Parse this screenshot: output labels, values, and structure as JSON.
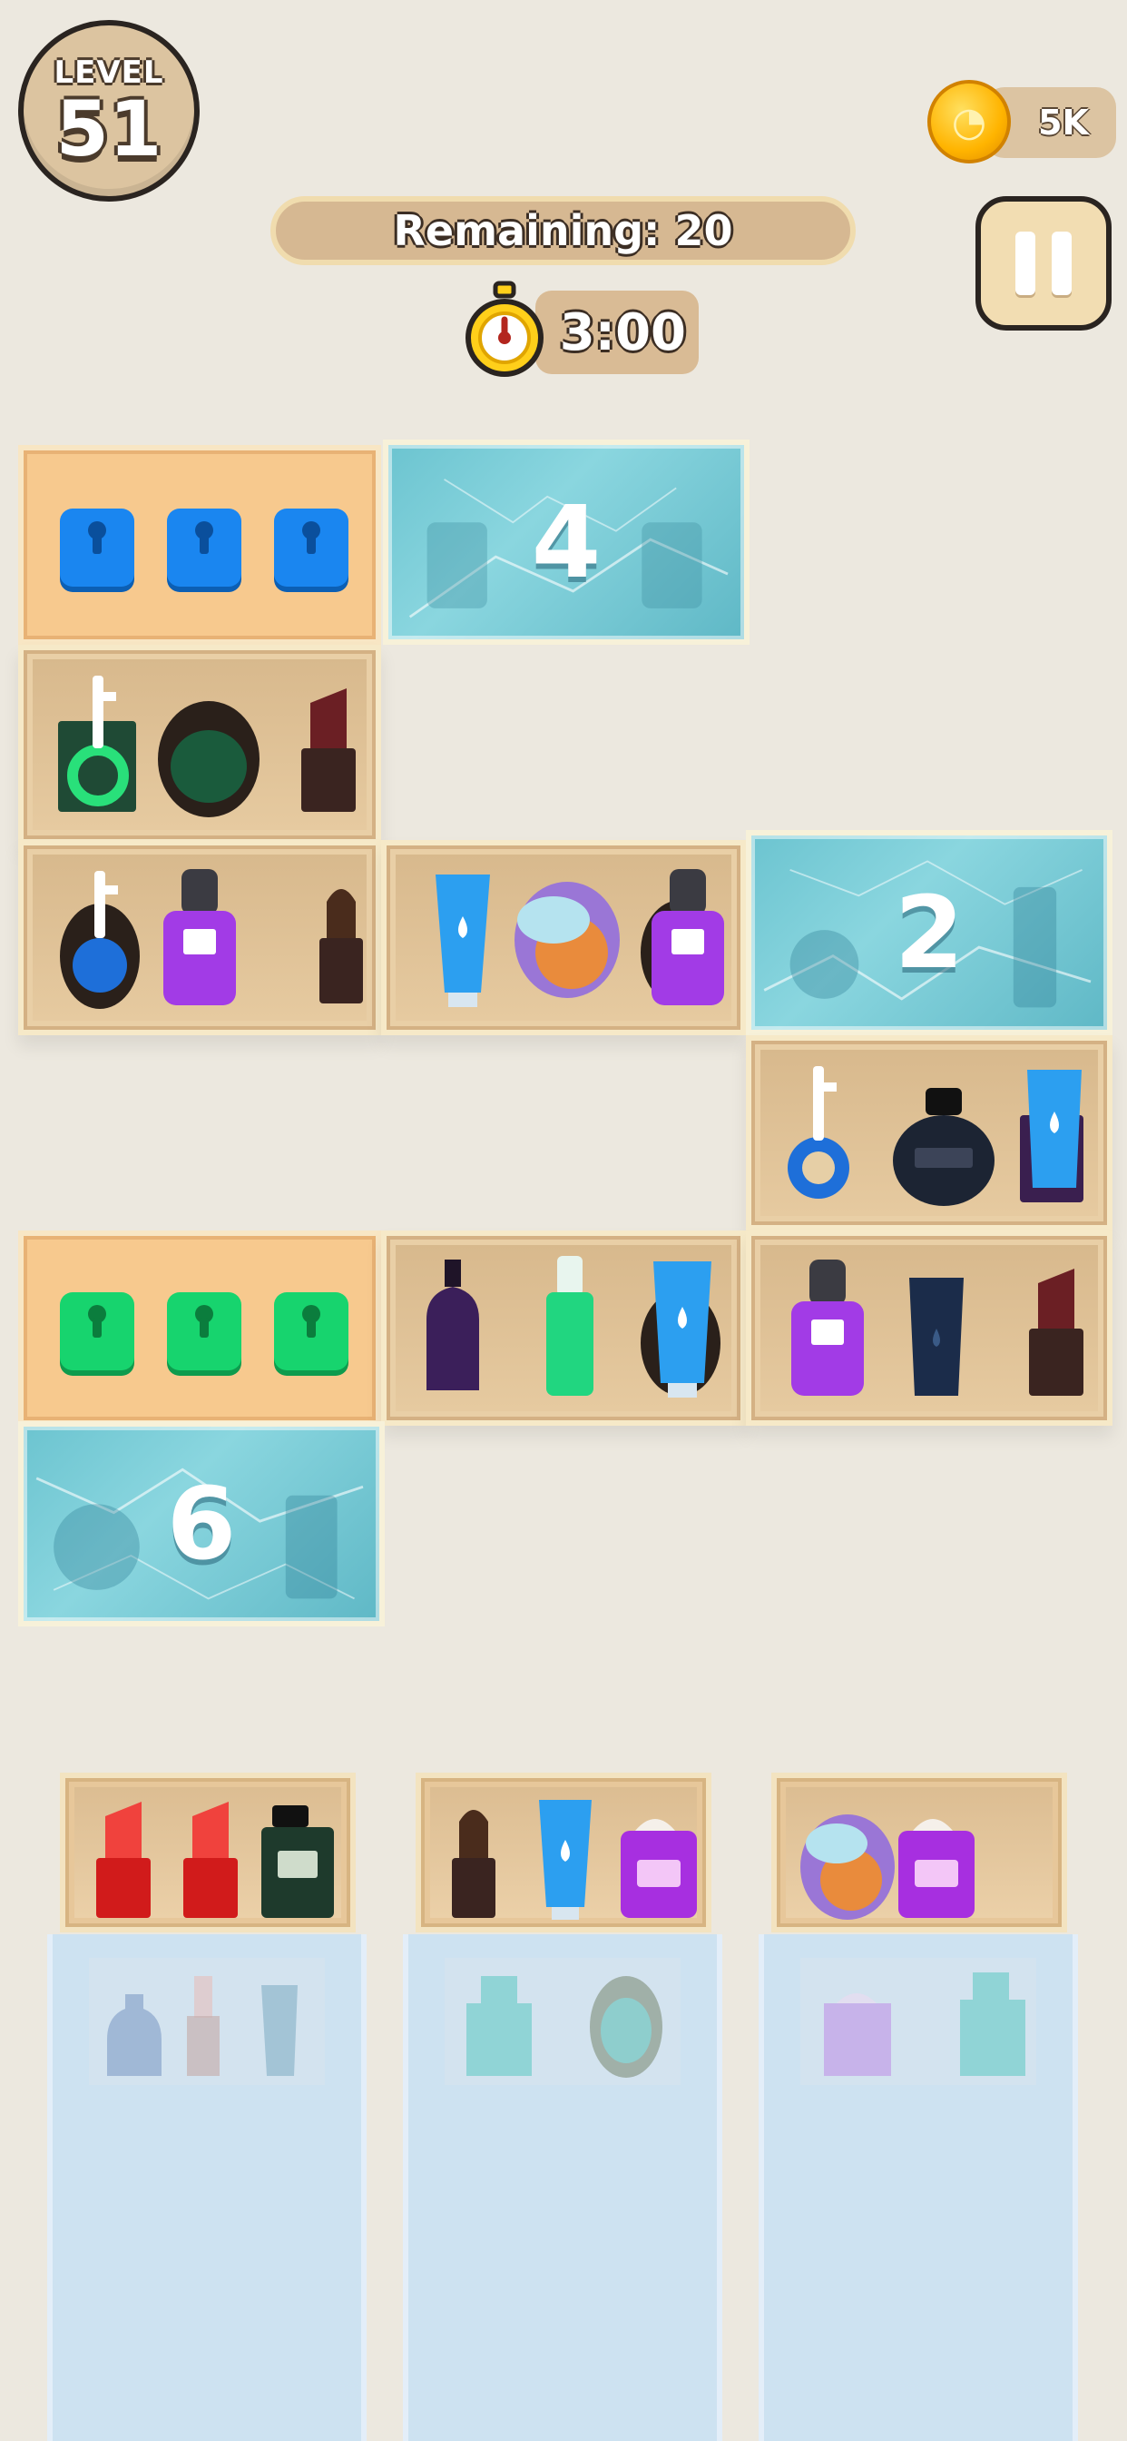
{
  "hud": {
    "level_label": "LEVEL",
    "level_number": "51",
    "coins": "5K",
    "remaining": "Remaining: 20",
    "timer": "3:00"
  },
  "ice_counters": {
    "top": "4",
    "right": "2",
    "bottom_left": "6"
  },
  "colors": {
    "background": "#ece8df",
    "shelf": "#e9cfa6",
    "lock_blue": "#1a86f0",
    "lock_green": "#17d46e",
    "ice": "#7fcdd7",
    "queue": "#cfe4f5"
  }
}
